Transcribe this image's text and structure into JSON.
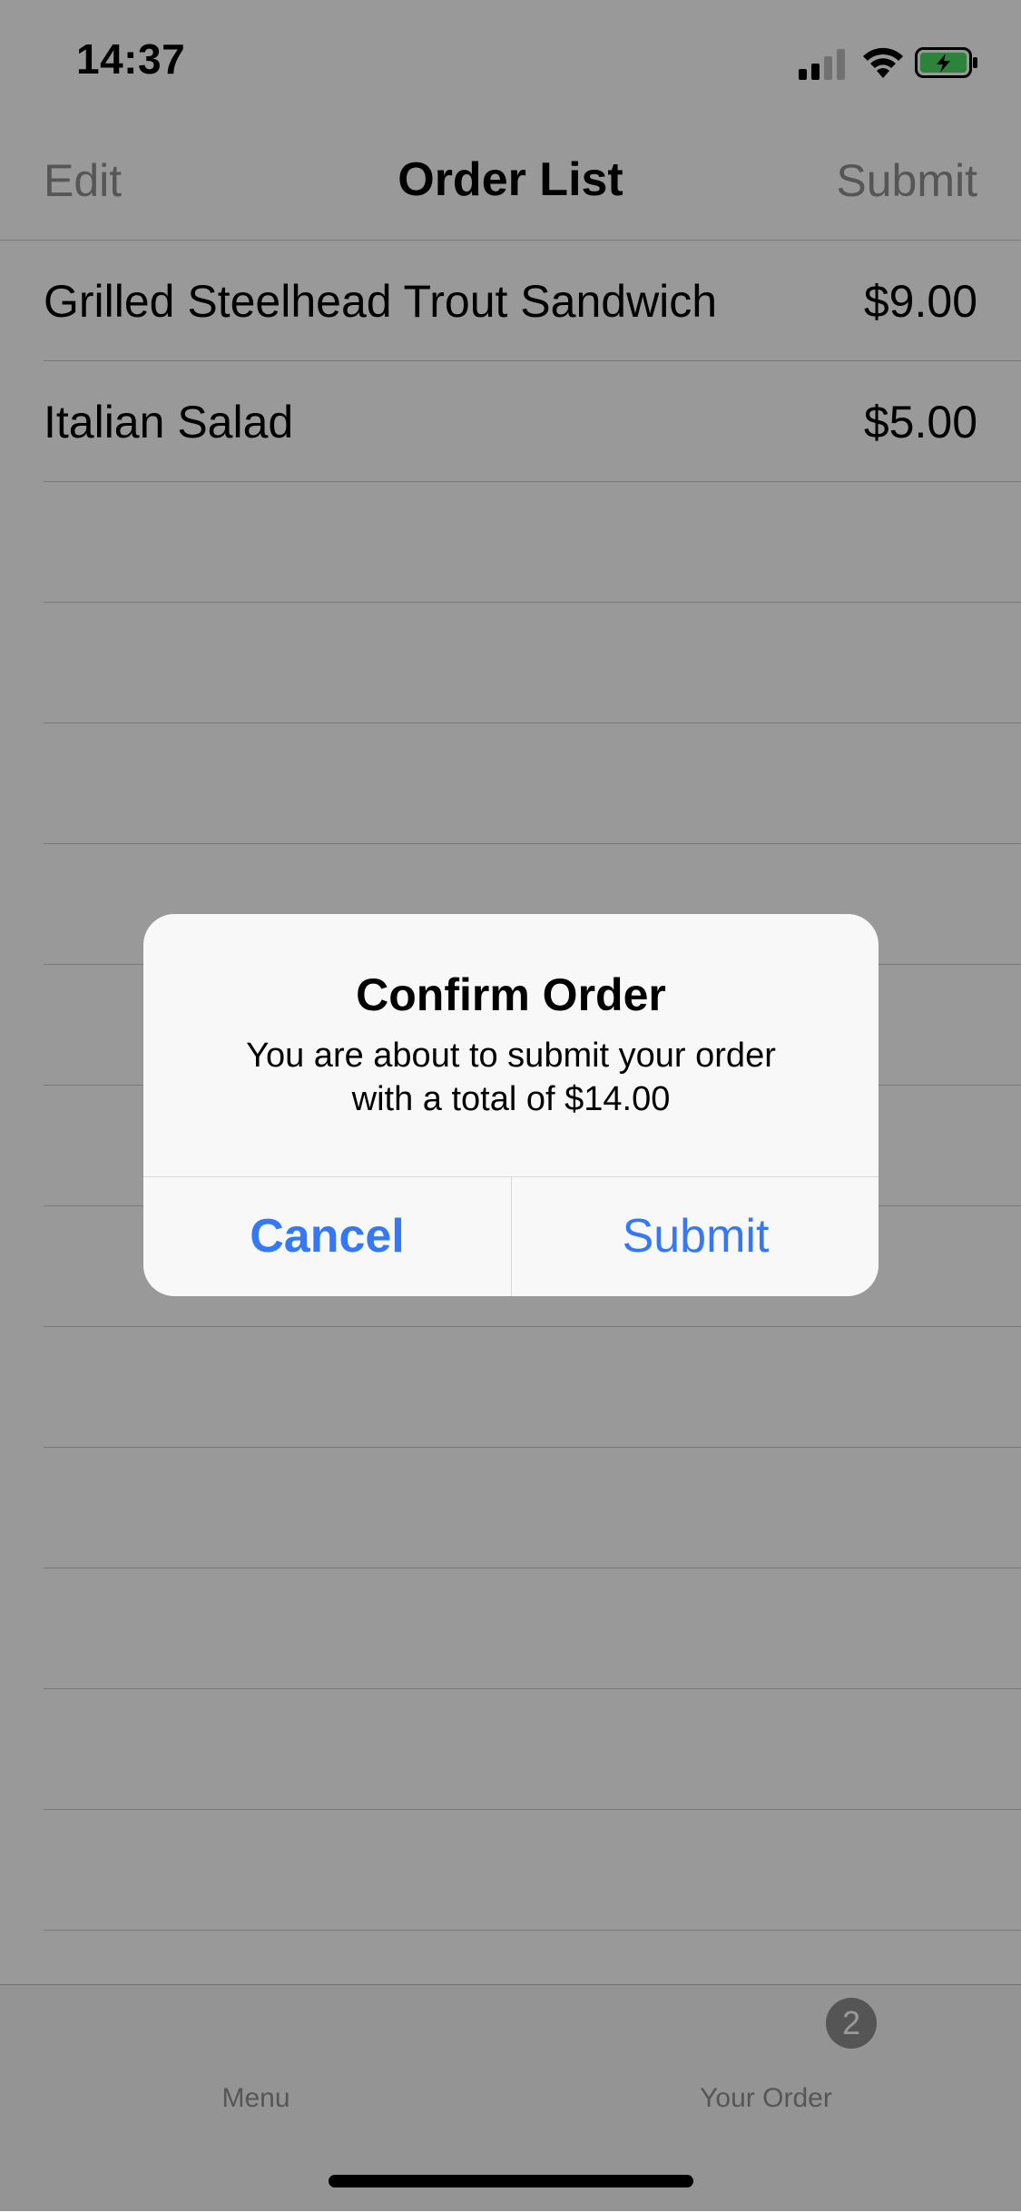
{
  "status_bar": {
    "time": "14:37",
    "icons": [
      "cellular-signal-icon",
      "wifi-icon",
      "battery-charging-icon"
    ],
    "battery_color": "#4cd964"
  },
  "nav": {
    "left_label": "Edit",
    "title": "Order List",
    "right_label": "Submit"
  },
  "order_items": [
    {
      "name": "Grilled Steelhead Trout Sandwich",
      "price": "$9.00"
    },
    {
      "name": "Italian Salad",
      "price": "$5.00"
    }
  ],
  "tab_bar": {
    "tabs": [
      {
        "label": "Menu"
      },
      {
        "label": "Your Order",
        "badge": "2"
      }
    ]
  },
  "alert": {
    "title": "Confirm Order",
    "message_line1": "You are about to submit your order",
    "message_line2": "with a total of $14.00",
    "cancel_label": "Cancel",
    "submit_label": "Submit",
    "accent_color": "#3478f6"
  }
}
